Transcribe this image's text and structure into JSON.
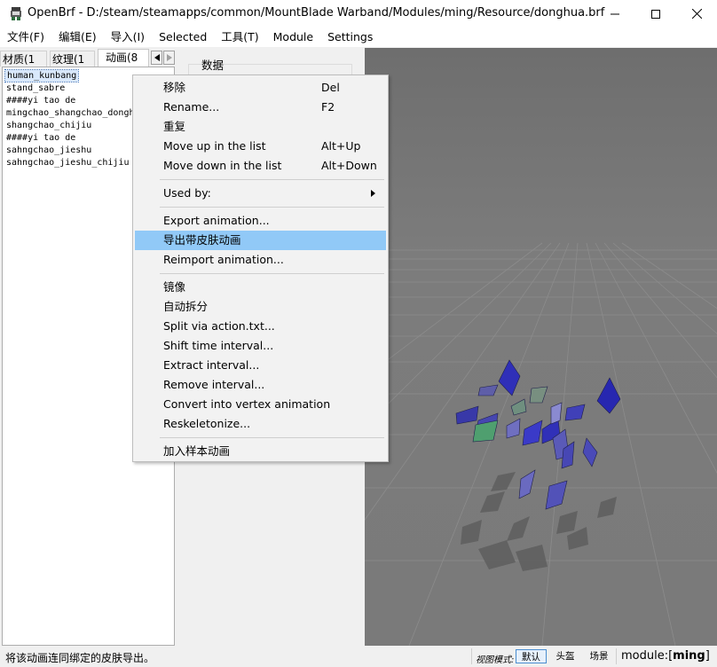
{
  "window": {
    "title": "OpenBrf - D:/steam/steamapps/common/MountBlade Warband/Modules/ming/Resource/donghua.brf"
  },
  "menubar": {
    "items": [
      "文件(F)",
      "编辑(E)",
      "导入(I)",
      "Selected",
      "工具(T)",
      "Module",
      "Settings"
    ]
  },
  "tabs": [
    "材质(1",
    "纹理(1",
    "动画(8"
  ],
  "list": {
    "items": [
      "human_kunbang",
      "stand_sabre",
      "####yi tao de",
      "mingchao_shangchao_dongh",
      "shangchao_chijiu",
      "####yi tao de",
      "sahngchao_jieshu",
      "sahngchao_jieshu_chijiu"
    ]
  },
  "data_panel": {
    "label": "数据"
  },
  "context_menu": {
    "items": [
      {
        "label": "移除",
        "shortcut": "Del"
      },
      {
        "label": "Rename...",
        "shortcut": "F2"
      },
      {
        "label": "重复",
        "shortcut": ""
      },
      {
        "label": "Move up in the list",
        "shortcut": "Alt+Up"
      },
      {
        "label": "Move down in the list",
        "shortcut": "Alt+Down"
      },
      {
        "label": "Used by:",
        "shortcut": ""
      },
      {
        "label": "Export animation...",
        "shortcut": ""
      },
      {
        "label": "导出带皮肤动画",
        "shortcut": ""
      },
      {
        "label": "Reimport animation...",
        "shortcut": ""
      },
      {
        "label": "镜像",
        "shortcut": ""
      },
      {
        "label": "自动拆分",
        "shortcut": ""
      },
      {
        "label": "Split via action.txt...",
        "shortcut": ""
      },
      {
        "label": "Shift time interval...",
        "shortcut": ""
      },
      {
        "label": "Extract interval...",
        "shortcut": ""
      },
      {
        "label": "Remove interval...",
        "shortcut": ""
      },
      {
        "label": "Convert into vertex animation",
        "shortcut": ""
      },
      {
        "label": "Reskeletonize...",
        "shortcut": ""
      },
      {
        "label": "加入样本动画",
        "shortcut": ""
      }
    ]
  },
  "statusbar": {
    "message": "将该动画连同绑定的皮肤导出。",
    "view_mode_label": "视图模式:",
    "view_buttons": [
      "默认",
      "头盔",
      "场景"
    ],
    "module_prefix": "module:[",
    "module_name": "ming",
    "module_suffix": "]"
  },
  "colors": {
    "highlight": "#91c9f7",
    "viewport_bg": "#7a7a7a",
    "bone_blue": "#3a3ac8",
    "bone_green": "#4f9f6f"
  }
}
